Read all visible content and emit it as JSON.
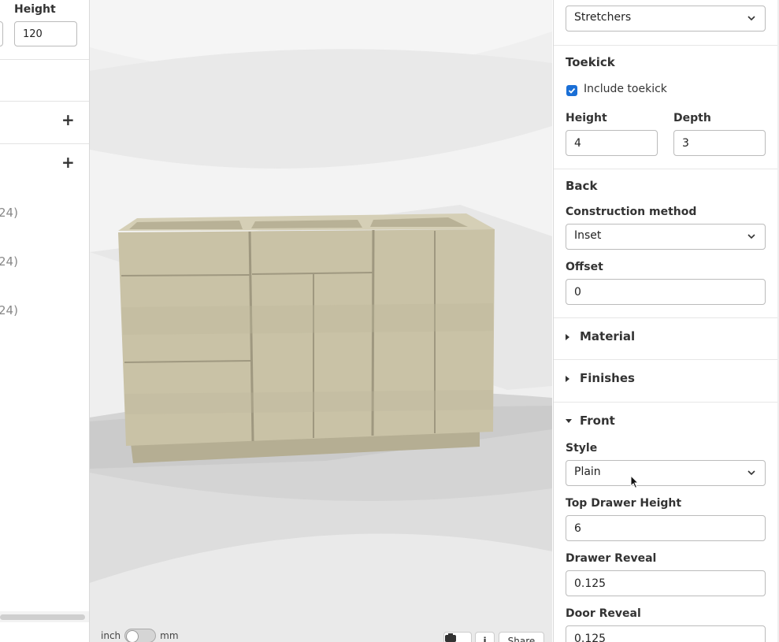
{
  "left_panel": {
    "height_label": "Height",
    "height_value": "120",
    "list_items": [
      "24)",
      "24)",
      "24)"
    ]
  },
  "viewport": {
    "unit_left": "inch",
    "unit_right": "mm",
    "share_label": "Share",
    "info_label": "i"
  },
  "right_panel": {
    "top_select": "Stretchers",
    "toekick": {
      "heading": "Toekick",
      "checkbox_label": "Include toekick",
      "checked": true,
      "height_label": "Height",
      "height_value": "4",
      "depth_label": "Depth",
      "depth_value": "3"
    },
    "back": {
      "heading": "Back",
      "method_label": "Construction method",
      "method_value": "Inset",
      "offset_label": "Offset",
      "offset_value": "0"
    },
    "material_heading": "Material",
    "finishes_heading": "Finishes",
    "front": {
      "heading": "Front",
      "style_label": "Style",
      "style_value": "Plain",
      "top_drawer_label": "Top Drawer Height",
      "top_drawer_value": "6",
      "drawer_reveal_label": "Drawer Reveal",
      "drawer_reveal_value": "0.125",
      "door_reveal_label": "Door Reveal",
      "door_reveal_value": "0.125"
    }
  },
  "colors": {
    "accent": "#1a6fd6",
    "cabinet": "#c9c2a6",
    "background": "#efefef"
  }
}
